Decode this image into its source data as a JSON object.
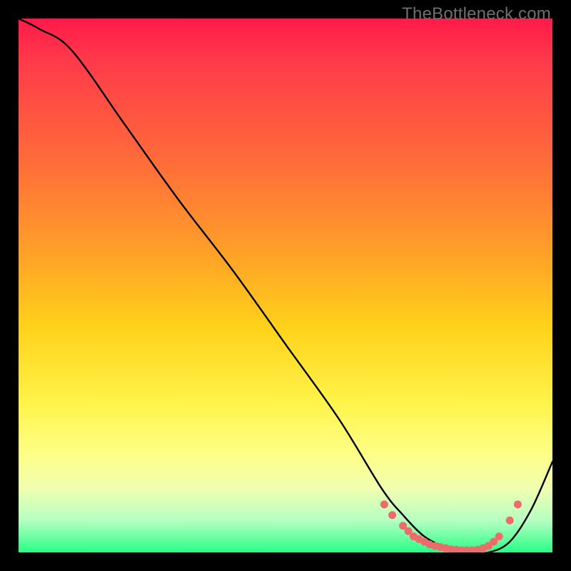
{
  "attribution": "TheBottleneck.com",
  "chart_data": {
    "type": "line",
    "title": "",
    "xlabel": "",
    "ylabel": "",
    "xlim": [
      0,
      100
    ],
    "ylim": [
      0,
      100
    ],
    "series": [
      {
        "name": "bottleneck-curve",
        "x": [
          0,
          4,
          10,
          20,
          30,
          40,
          50,
          60,
          68,
          72,
          76,
          80,
          84,
          88,
          92,
          96,
          100
        ],
        "y": [
          100,
          98,
          94,
          80,
          66,
          53,
          39,
          25,
          12,
          7,
          3,
          1,
          0,
          0,
          2,
          8,
          17
        ]
      }
    ],
    "markers": {
      "name": "highlight-dots",
      "color": "#ef6b6b",
      "x": [
        68.5,
        70,
        72,
        73,
        74,
        75,
        76,
        77,
        78,
        79,
        80,
        81,
        82,
        83,
        84,
        85,
        86,
        87,
        88,
        89,
        90,
        92,
        93.5
      ],
      "y": [
        9,
        7,
        5,
        4,
        3,
        2.5,
        2,
        1.5,
        1.2,
        1,
        0.8,
        0.6,
        0.5,
        0.4,
        0.4,
        0.4,
        0.5,
        0.8,
        1.2,
        2,
        3,
        6,
        9
      ]
    }
  }
}
